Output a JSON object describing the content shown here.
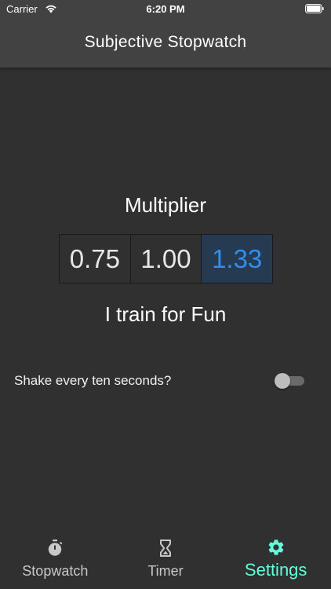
{
  "status_bar": {
    "carrier": "Carrier",
    "time": "6:20 PM"
  },
  "app_bar": {
    "title": "Subjective Stopwatch"
  },
  "multiplier": {
    "label": "Multiplier",
    "options": [
      "0.75",
      "1.00",
      "1.33"
    ],
    "selected": "1.33",
    "description": "I train for Fun"
  },
  "shake": {
    "label": "Shake every ten seconds?",
    "enabled": false
  },
  "bottom_nav": {
    "items": [
      {
        "label": "Stopwatch",
        "icon": "stopwatch-icon"
      },
      {
        "label": "Timer",
        "icon": "hourglass-icon"
      },
      {
        "label": "Settings",
        "icon": "gear-icon"
      }
    ],
    "active": "Settings"
  },
  "colors": {
    "accent": "#64ffda",
    "selected_text": "#2f8ef0",
    "selected_bg": "#263a52",
    "background": "#303030",
    "app_bar": "#424242"
  }
}
